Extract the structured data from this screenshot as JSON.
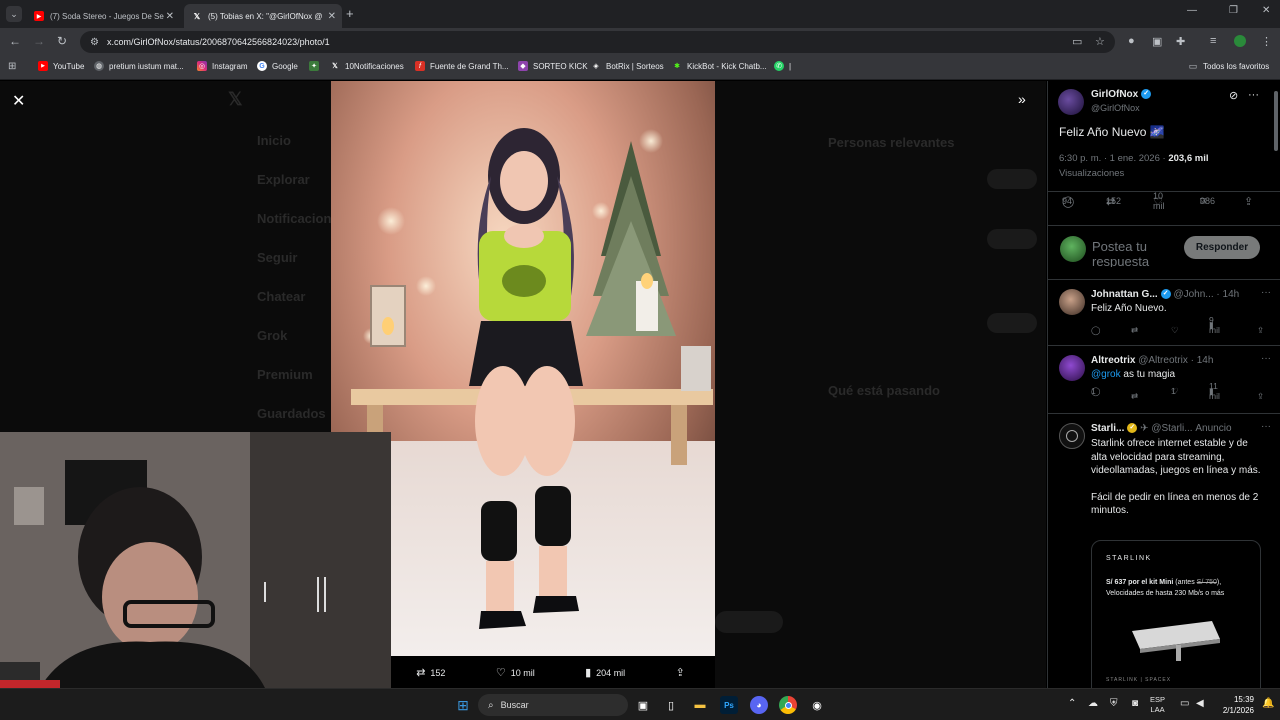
{
  "browser": {
    "tabs": [
      {
        "label": "(7) Soda Stereo - Juegos De Se",
        "icon": "youtube-icon",
        "active": false
      },
      {
        "label": "(5) Tobias en X: \"@GirlOfNox @",
        "icon": "x-icon",
        "active": true
      }
    ],
    "url": "x.com/GirlOfNox/status/2006870642566824023/photo/1",
    "bookmarks": [
      {
        "label": "YouTube",
        "icon": "youtube-icon"
      },
      {
        "label": "pretium iustum mat...",
        "icon": "globe-icon"
      },
      {
        "label": "Instagram",
        "icon": "instagram-icon"
      },
      {
        "label": "Google",
        "icon": "google-icon"
      },
      {
        "label": "10Notificaciones",
        "icon": "x-icon"
      },
      {
        "label": "Fuente de Grand Th...",
        "icon": "font-icon"
      },
      {
        "label": "SORTEO KICK",
        "icon": "kick-icon"
      },
      {
        "label": "BotRix | Sorteos",
        "icon": "botrix-icon"
      },
      {
        "label": "KickBot - Kick Chatb...",
        "icon": "kickbot-icon"
      },
      {
        "label": "|",
        "icon": "whatsapp-icon"
      }
    ],
    "all_bookmarks": "Todos los favoritos"
  },
  "photo_bar": {
    "retweets": "152",
    "likes": "10 mil",
    "views": "204 mil"
  },
  "post": {
    "author_name": "GirlOfNox",
    "author_handle": "@GirlOfNox",
    "text": "Feliz Año Nuevo 🌌",
    "time": "6:30 p. m. · 1 ene. 2026 · ",
    "views_count": "203,6 mil",
    "views_label": "Visualizaciones",
    "replies": "94",
    "retweets": "152",
    "likes": "10 mil",
    "bookmarks": "986"
  },
  "composer": {
    "placeholder": "Postea tu respuesta",
    "button": "Responder"
  },
  "replies": [
    {
      "name": "Johnattan G...",
      "handle": "@John... · 14h",
      "text": "Feliz Año Nuevo.",
      "replies": "",
      "retweets": "",
      "likes": "",
      "views": "9 mil"
    },
    {
      "name": "Altreotrix",
      "handle": "@Altreotrix · 14h",
      "mention": "@grok",
      "text": " as tu magia",
      "replies": "1",
      "retweets": "",
      "likes": "1",
      "views": "11 mil"
    }
  ],
  "ad": {
    "name": "Starli...",
    "handle": "@Starli...",
    "label": "Anuncio",
    "body1": "Starlink ofrece internet estable y de alta velocidad para streaming, videollamadas, juegos en línea y más.",
    "body2": "Fácil de pedir en línea en menos de 2 minutos.",
    "card_brand": "STARLINK",
    "card_offer_prefix": "S/ 637 por el kit Mini",
    "card_offer_old_a": " (antes ",
    "card_offer_old": "S/ 750",
    "card_offer_old_b": "),",
    "card_offer_line2": "Velocidades de hasta 230 Mb/s o más",
    "card_footer": "STARLINK | SPACEX"
  },
  "background_ghost": {
    "nav": [
      "Inicio",
      "Explorar",
      "Notificaciones",
      "Seguir",
      "Chatear",
      "Grok",
      "Premium",
      "Guardados"
    ],
    "relevant": "Personas relevantes",
    "trending": "Qué está pasando"
  },
  "taskbar": {
    "search": "Buscar",
    "lang_top": "ESP",
    "lang_bottom": "LAA",
    "time": "15:39",
    "date": "2/1/2026"
  },
  "colors": {
    "accent": "#1d9bf0",
    "verified_gold": "#e2b719"
  }
}
